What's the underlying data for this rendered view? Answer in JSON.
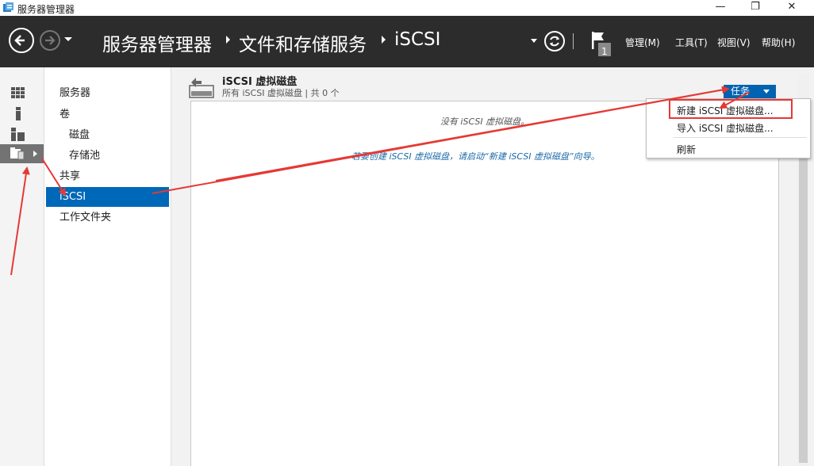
{
  "window": {
    "title": "服务器管理器",
    "minimize_glyph": "—",
    "maximize_glyph": "❐",
    "close_glyph": "✕"
  },
  "header": {
    "breadcrumb": [
      "服务器管理器",
      "文件和存储服务",
      "iSCSI"
    ],
    "menus": [
      "管理(M)",
      "工具(T)",
      "视图(V)",
      "帮助(H)"
    ],
    "notification_count": "1"
  },
  "left_strip": {
    "icons": [
      "dashboard-icon",
      "local-server-icon",
      "all-servers-icon",
      "file-storage-icon"
    ],
    "selected_index": 3
  },
  "nav": {
    "items": [
      {
        "label": "服务器",
        "level": 0
      },
      {
        "label": "卷",
        "level": 0
      },
      {
        "label": "磁盘",
        "level": 1
      },
      {
        "label": "存储池",
        "level": 1
      },
      {
        "label": "共享",
        "level": 0
      },
      {
        "label": "iSCSI",
        "level": 0,
        "selected": true
      },
      {
        "label": "工作文件夹",
        "level": 0
      }
    ]
  },
  "tile": {
    "title": "iSCSI 虚拟磁盘",
    "subtitle": "所有 iSCSI 虚拟磁盘 | 共 0 个",
    "tasks_label": "任务",
    "empty_message": "没有 iSCSI 虚拟磁盘。",
    "hint_message": "若要创建 iSCSI 虚拟磁盘，请启动“新建 iSCSI 虚拟磁盘”向导。"
  },
  "tasks_menu": {
    "items": [
      "新建 iSCSI 虚拟磁盘...",
      "导入 iSCSI 虚拟磁盘...",
      "刷新"
    ]
  },
  "colors": {
    "header_bg": "#2c2c2c",
    "accent": "#0068b8",
    "tasks_button": "#0063b1",
    "annotation": "#e53935"
  }
}
